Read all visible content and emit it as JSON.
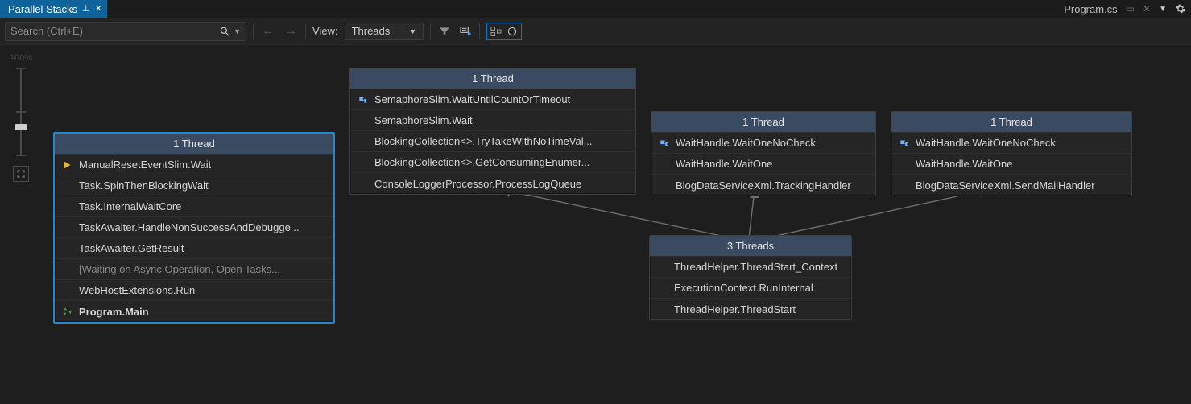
{
  "titlebar": {
    "tab_label": "Parallel Stacks",
    "file_label": "Program.cs"
  },
  "toolbar": {
    "search_placeholder": "Search (Ctrl+E)",
    "view_label": "View:",
    "view_value": "Threads"
  },
  "zoom": {
    "pct": "100%"
  },
  "nodes": {
    "n1": {
      "header": "1 Thread",
      "rows": [
        {
          "icon": "arrow",
          "text": "ManualResetEventSlim.Wait"
        },
        {
          "text": "Task.SpinThenBlockingWait"
        },
        {
          "text": "Task.InternalWaitCore"
        },
        {
          "text": "TaskAwaiter.HandleNonSuccessAndDebugge..."
        },
        {
          "text": "TaskAwaiter.GetResult"
        },
        {
          "dim": true,
          "text": "[Waiting on Async Operation, Open Tasks..."
        },
        {
          "text": "WebHostExtensions.Run"
        },
        {
          "icon": "recycle",
          "bold": true,
          "text": "Program.Main"
        }
      ]
    },
    "n2": {
      "header": "1 Thread",
      "rows": [
        {
          "icon": "threads",
          "text": "SemaphoreSlim.WaitUntilCountOrTimeout"
        },
        {
          "text": "SemaphoreSlim.Wait"
        },
        {
          "text": "BlockingCollection<>.TryTakeWithNoTimeVal..."
        },
        {
          "text": "BlockingCollection<>.GetConsumingEnumer..."
        },
        {
          "text": "ConsoleLoggerProcessor.ProcessLogQueue"
        }
      ]
    },
    "n3": {
      "header": "1 Thread",
      "rows": [
        {
          "icon": "threads",
          "text": "WaitHandle.WaitOneNoCheck"
        },
        {
          "text": "WaitHandle.WaitOne"
        },
        {
          "text": "BlogDataServiceXml.TrackingHandler"
        }
      ]
    },
    "n4": {
      "header": "1 Thread",
      "rows": [
        {
          "icon": "threads",
          "text": "WaitHandle.WaitOneNoCheck"
        },
        {
          "text": "WaitHandle.WaitOne"
        },
        {
          "text": "BlogDataServiceXml.SendMailHandler"
        }
      ]
    },
    "n5": {
      "header": "3 Threads",
      "rows": [
        {
          "text": "ThreadHelper.ThreadStart_Context"
        },
        {
          "text": "ExecutionContext.RunInternal"
        },
        {
          "text": "ThreadHelper.ThreadStart"
        }
      ]
    }
  }
}
